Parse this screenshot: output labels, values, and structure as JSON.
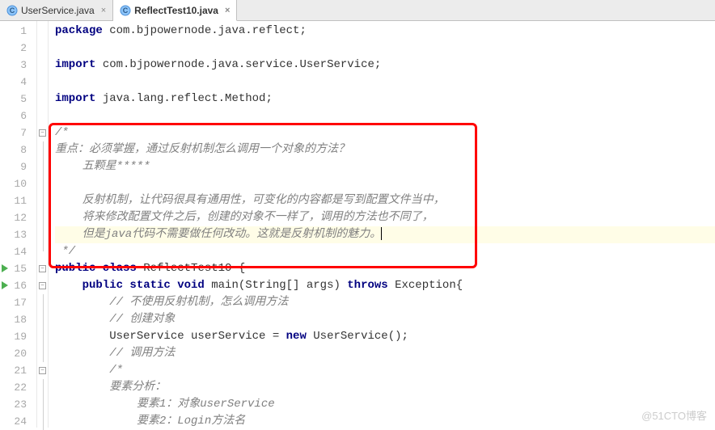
{
  "tabs": [
    {
      "label": "UserService.java",
      "active": false
    },
    {
      "label": "ReflectTest10.java",
      "active": true
    }
  ],
  "lines": {
    "l1_kw": "package",
    "l1_rest": " com.bjpowernode.java.reflect;",
    "l3_kw": "import",
    "l3_rest": " com.bjpowernode.java.service.UserService;",
    "l5_kw": "import",
    "l5_rest": " java.lang.reflect.Method;",
    "l7": "/*",
    "l8": "重点：必须掌握，通过反射机制怎么调用一个对象的方法？",
    "l9": "    五颗星*****",
    "l10": "",
    "l11": "    反射机制，让代码很具有通用性，可变化的内容都是写到配置文件当中，",
    "l12": "    将来修改配置文件之后，创建的对象不一样了，调用的方法也不同了，",
    "l13": "    但是java代码不需要做任何改动。这就是反射机制的魅力。",
    "l14": " */",
    "l15_kw1": "public class",
    "l15_name": " ReflectTest10 {",
    "l16_kw1": "public static void",
    "l16_mid": " main(String[] args) ",
    "l16_kw2": "throws",
    "l16_rest": " Exception{",
    "l17": "// 不使用反射机制，怎么调用方法",
    "l18": "// 创建对象",
    "l19_a": "UserService userService = ",
    "l19_kw": "new",
    "l19_b": " UserService();",
    "l20": "// 调用方法",
    "l21": "/*",
    "l22": "要素分析：",
    "l23": "    要素1：对象userService",
    "l24": "    要素2：Login方法名"
  },
  "watermark": "@51CTO博客"
}
